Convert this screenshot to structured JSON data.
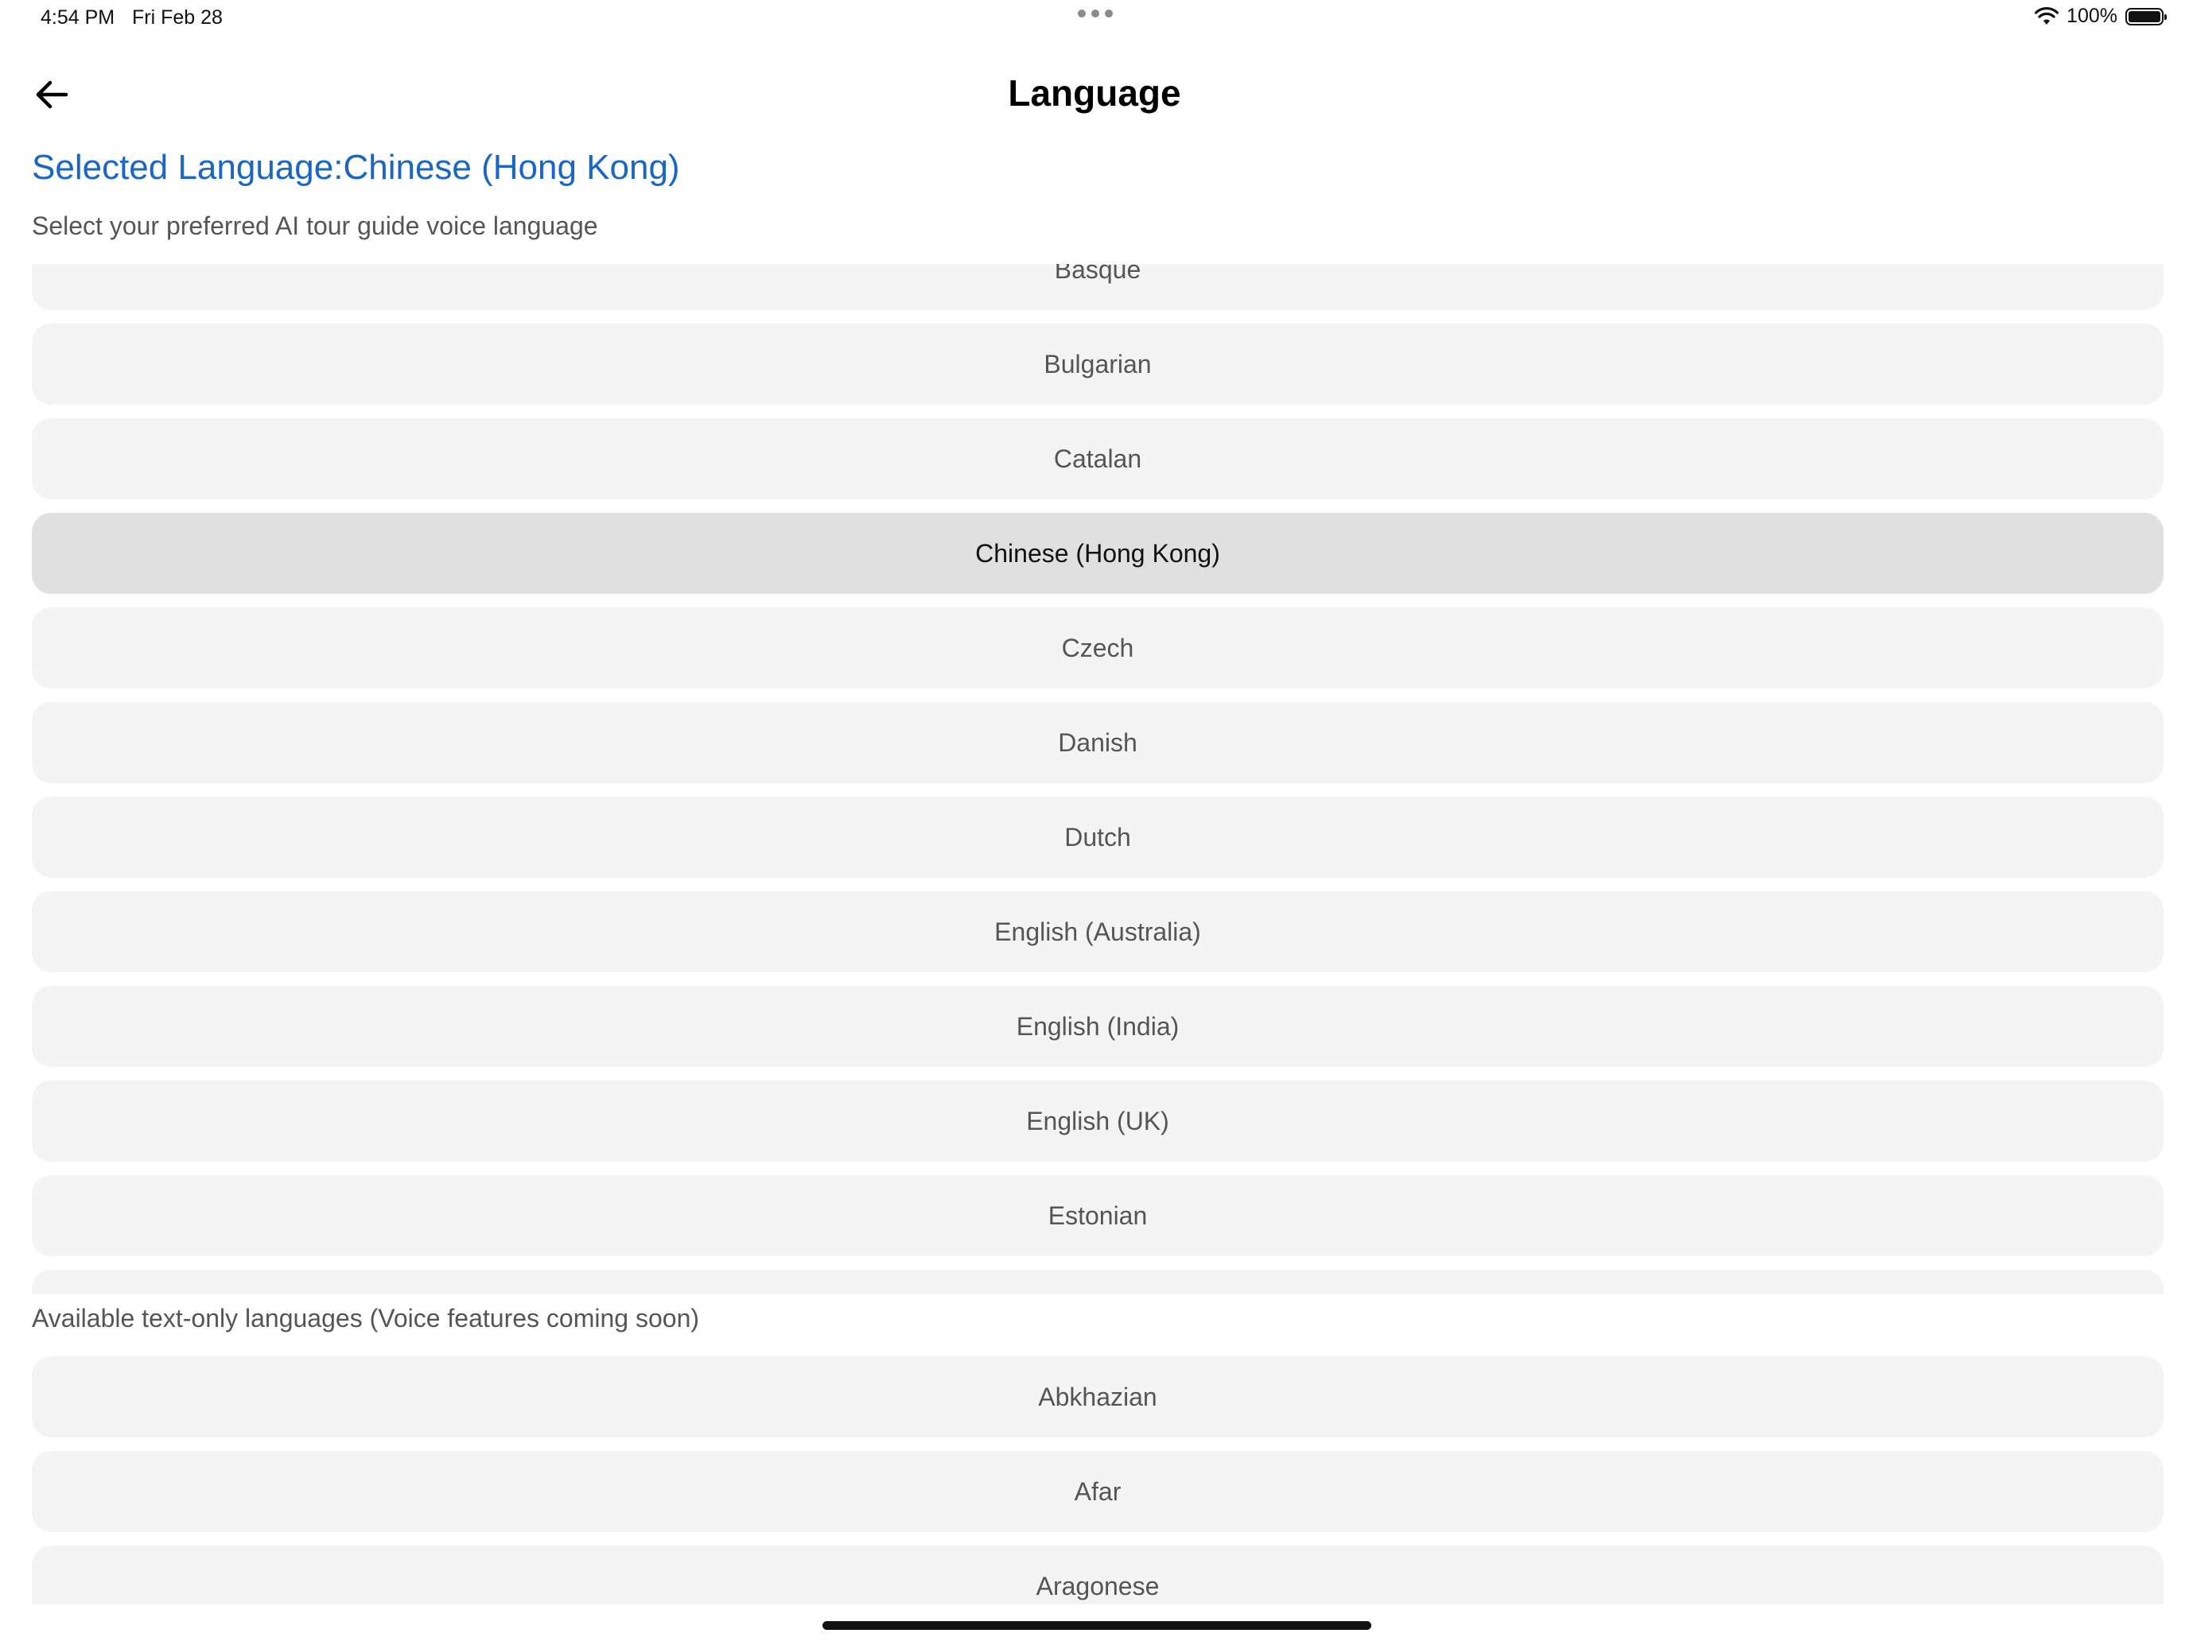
{
  "status_bar": {
    "time": "4:54 PM",
    "date": "Fri Feb 28",
    "battery_percent": "100%",
    "battery_level": 1.0,
    "icons": [
      "multitask-dots-icon",
      "wifi-icon",
      "battery-icon"
    ]
  },
  "header": {
    "title": "Language",
    "back_icon": "arrow-left-icon"
  },
  "selected": {
    "label": "Selected Language:Chinese (Hong Kong)"
  },
  "subtitle": "Select your preferred AI tour guide voice language",
  "voice_languages": [
    {
      "label": "Basque"
    },
    {
      "label": "Bulgarian"
    },
    {
      "label": "Catalan"
    },
    {
      "label": "Chinese (Hong Kong)",
      "selected": true
    },
    {
      "label": "Czech"
    },
    {
      "label": "Danish"
    },
    {
      "label": "Dutch"
    },
    {
      "label": "English (Australia)"
    },
    {
      "label": "English (India)"
    },
    {
      "label": "English (UK)"
    },
    {
      "label": "Estonian"
    },
    {
      "label": ""
    }
  ],
  "text_only": {
    "heading": "Available text-only languages (Voice features coming soon)",
    "languages": [
      {
        "label": "Abkhazian"
      },
      {
        "label": "Afar"
      },
      {
        "label": "Aragonese"
      }
    ]
  },
  "colors": {
    "accent": "#1a66c2",
    "item_bg": "#f4f4f4",
    "item_selected_bg": "#e0e0e0"
  }
}
